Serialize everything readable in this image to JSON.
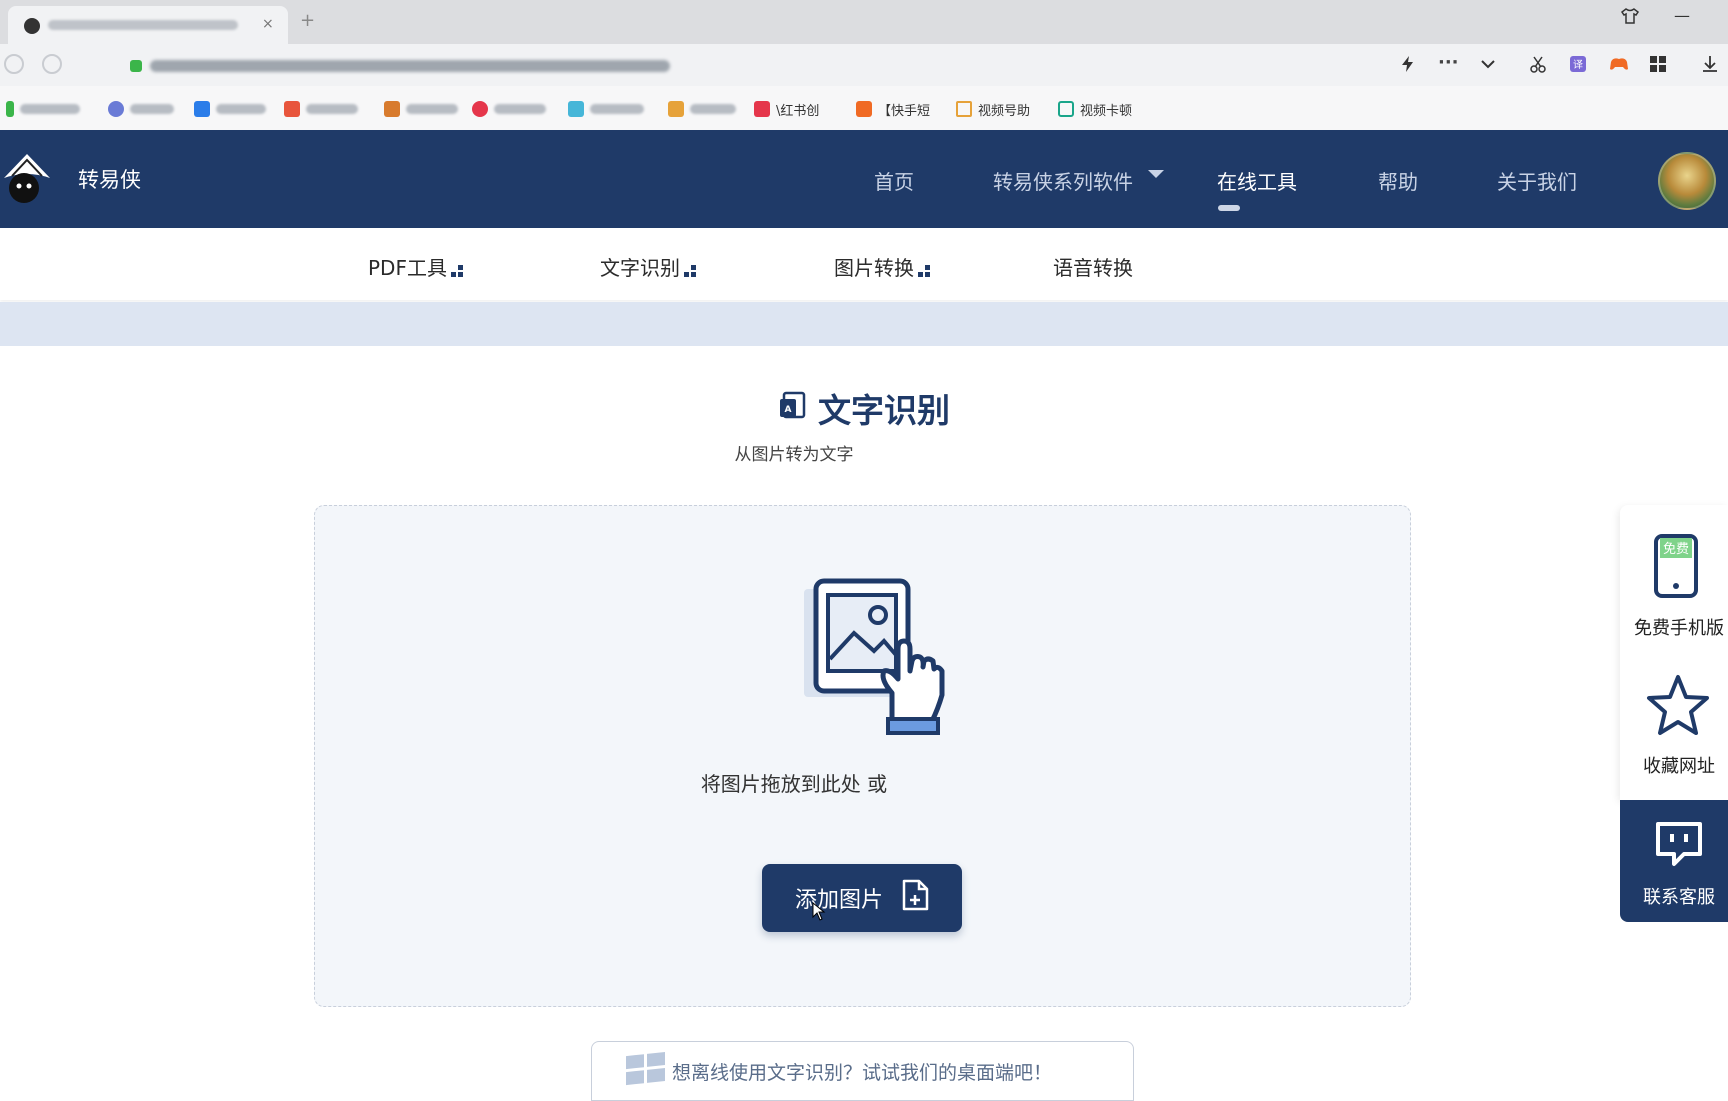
{
  "browser": {
    "tab_close": "×",
    "new_tab": "+",
    "minimize": "—",
    "toolbar_icons": [
      "flash-icon",
      "more-icon",
      "chevron-down-icon",
      "scissors-icon",
      "translate-icon",
      "game-icon",
      "apps-icon",
      "download-icon"
    ],
    "bookmarks": [
      {
        "label": "​",
        "color": "#3bb54a"
      },
      {
        "label": "​",
        "color": "#6a7bd6"
      },
      {
        "label": "​",
        "color": "#2b7de9"
      },
      {
        "label": "​",
        "color": "#e8553c"
      },
      {
        "label": "​",
        "color": "#d87b2e"
      },
      {
        "label": "​",
        "color": "#e5364b"
      },
      {
        "label": "​",
        "color": "#46b6d8"
      },
      {
        "label": "​",
        "color": "#e6a23a"
      },
      {
        "label": "​",
        "color": "#e5364b"
      },
      {
        "label": "​",
        "color": "#e8553c"
      }
    ],
    "bookmark_visible": [
      {
        "label": "\\红书创",
        "color": "#e5364b"
      },
      {
        "label": "【快手短",
        "color": "#f06a24"
      },
      {
        "label": "视频号助",
        "color": "#e6a23a"
      },
      {
        "label": "视频卡顿",
        "color": "#1aa58a"
      }
    ]
  },
  "header": {
    "brand": "转易侠",
    "nav": [
      {
        "label": "首页"
      },
      {
        "label": "转易侠系列软件"
      },
      {
        "label": "在线工具"
      },
      {
        "label": "帮助"
      },
      {
        "label": "关于我们"
      }
    ]
  },
  "subnav": [
    {
      "label": "PDF工具"
    },
    {
      "label": "文字识别"
    },
    {
      "label": "图片转换"
    },
    {
      "label": "语音转换"
    }
  ],
  "main": {
    "title": "文字识别",
    "subtitle": "从图片转为文字",
    "drop_text": "将图片拖放到此处 或",
    "add_button": "添加图片",
    "desktop_hint": "想离线使用文字识别？试试我们的桌面端吧！"
  },
  "float": {
    "mobile": "免费手机版",
    "mobile_badge": "免费",
    "bookmark": "收藏网址",
    "service": "联系客服"
  },
  "colors": {
    "brand_navy": "#1f3a68",
    "dropzone_bg": "#f3f6fa",
    "strip": "#dde5f2"
  }
}
